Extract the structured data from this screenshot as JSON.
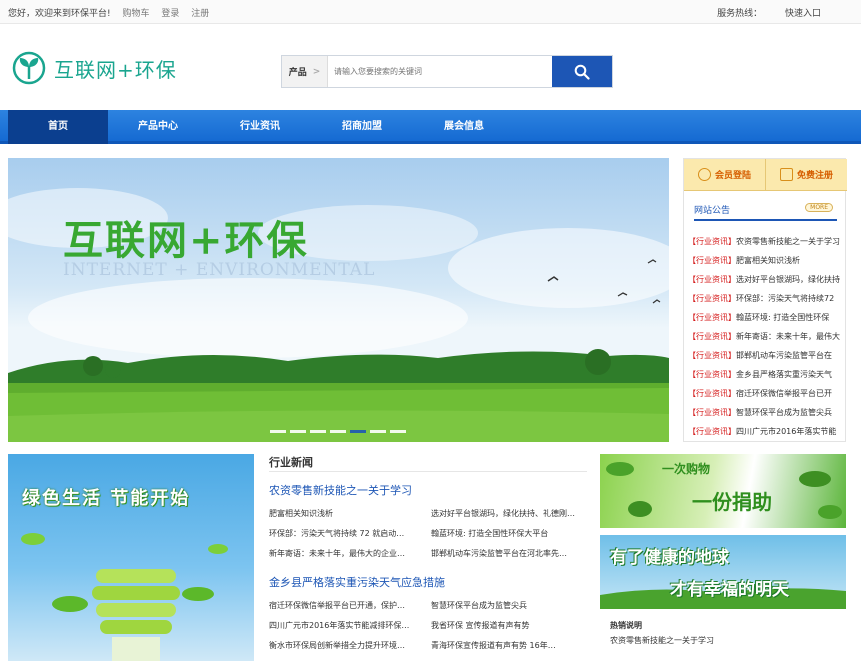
{
  "topbar": {
    "welcome": "您好，欢迎来到环保平台!",
    "cart": "购物车",
    "login": "登录",
    "register": "注册",
    "hotline": "服务热线：",
    "quick_entry": "快速入口"
  },
  "logo": {
    "text": "互联网+环保"
  },
  "search": {
    "category": "产品",
    "category_arrow": ">",
    "placeholder": "请输入您要搜索的关键词",
    "button_icon": "search-icon"
  },
  "nav": {
    "items": [
      "首页",
      "产品中心",
      "行业资讯",
      "招商加盟",
      "展会信息"
    ],
    "active": 0
  },
  "banner": {
    "title": "互联网+环保",
    "subtitle": "INTERNET + ENVIRONMENTAL",
    "slide_count": 7,
    "active_slide": 4
  },
  "sidebar": {
    "member_login": "会员登陆",
    "free_register": "免费注册",
    "notice_title": "网站公告",
    "more": "MORE",
    "notices": [
      {
        "tag": "【行业资讯】",
        "text": "农资零售新技能之一关于学习"
      },
      {
        "tag": "【行业资讯】",
        "text": "肥富相关知识浅析"
      },
      {
        "tag": "【行业资讯】",
        "text": "选对好平台银湖玛，绿化扶持"
      },
      {
        "tag": "【行业资讯】",
        "text": "环保部：污染天气将持续72"
      },
      {
        "tag": "【行业资讯】",
        "text": "翰蓝环境: 打造全国性环保"
      },
      {
        "tag": "【行业资讯】",
        "text": "新年寄语：未来十年，最伟大"
      },
      {
        "tag": "【行业资讯】",
        "text": "邯郸机动车污染监管平台在"
      },
      {
        "tag": "【行业资讯】",
        "text": "金乡县严格落实重污染天气"
      },
      {
        "tag": "【行业资讯】",
        "text": "宿迁环保微信举报平台已开"
      },
      {
        "tag": "【行业资讯】",
        "text": "智慧环保平台成为监管尖兵"
      },
      {
        "tag": "【行业资讯】",
        "text": "四川广元市2016年落实节能"
      }
    ]
  },
  "promo": {
    "text": "绿色生活 节能开始"
  },
  "news": {
    "section_title": "行业新闻",
    "headline1": "农资零售新技能之一关于学习",
    "list1": [
      "肥富相关知识浅析",
      "选对好平台银湖玛，绿化扶持、礼德刚…",
      "环保部：污染天气将持续 72 就启动…",
      "翰蓝环境: 打造全国性环保大平台",
      "新年寄语：未来十年，最伟大的企业…",
      "邯郸机动车污染监管平台在河北率先…"
    ],
    "headline2": "金乡县严格落实重污染天气应急措施",
    "list2": [
      "宿迁环保微信举报平台已开通，保护…",
      "智慧环保平台成为监管尖兵",
      "四川广元市2016年落实节能减排环保…",
      "我省环保 宣传报道有声有势",
      "衡水市环保局创新举措全力提升环境…",
      "青海环保宣传报道有声有势 16年…"
    ]
  },
  "ads": {
    "ad1_line1": "一次购物",
    "ad1_line2": "一份捐助",
    "ad2_line1": "有了健康的地球",
    "ad2_line2": "才有幸福的明天"
  },
  "recommend": {
    "section_title": "热销说明",
    "item": "农资零售新技能之一关于学习"
  }
}
